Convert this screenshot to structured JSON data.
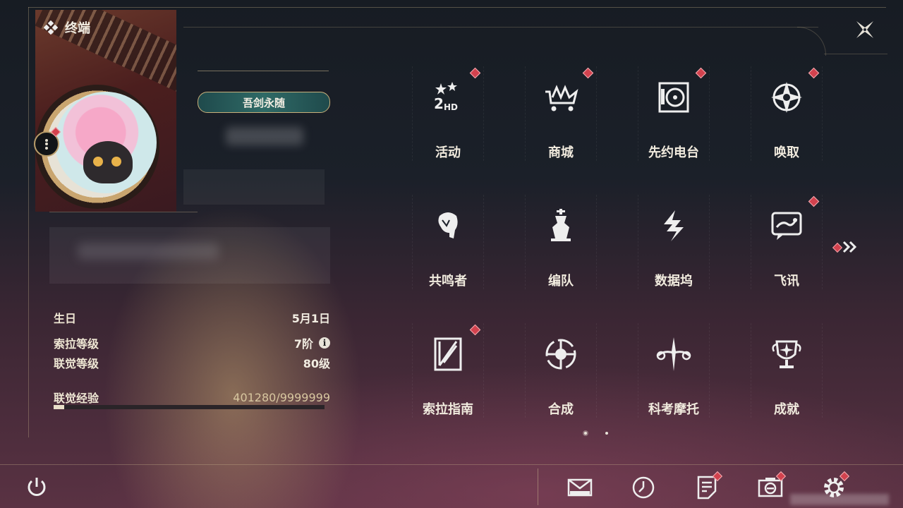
{
  "header": {
    "title": "终端"
  },
  "profile": {
    "title_badge": "吾剑永随",
    "stats": {
      "birthday_label": "生日",
      "birthday_value": "5月1日",
      "sola_level_label": "索拉等级",
      "sola_level_value": "7阶",
      "union_level_label": "联觉等级",
      "union_level_value": "80级",
      "union_exp_label": "联觉经验",
      "union_exp_value": "401280/9999999",
      "union_exp_progress": 0.04
    }
  },
  "menu": {
    "items": [
      {
        "label": "活动",
        "icon": "event-2hd-icon",
        "badge": true
      },
      {
        "label": "商城",
        "icon": "shop-cart-icon",
        "badge": true
      },
      {
        "label": "先约电台",
        "icon": "radio-icon",
        "badge": true
      },
      {
        "label": "唤取",
        "icon": "convene-icon",
        "badge": true
      },
      {
        "label": "共鸣者",
        "icon": "resonator-icon",
        "badge": false
      },
      {
        "label": "编队",
        "icon": "team-chess-icon",
        "badge": false
      },
      {
        "label": "数据坞",
        "icon": "data-bank-icon",
        "badge": false
      },
      {
        "label": "飞讯",
        "icon": "message-icon",
        "badge": true
      },
      {
        "label": "索拉指南",
        "icon": "guidebook-icon",
        "badge": true
      },
      {
        "label": "合成",
        "icon": "synthesis-icon",
        "badge": false
      },
      {
        "label": "科考摩托",
        "icon": "motorcycle-icon",
        "badge": false
      },
      {
        "label": "成就",
        "icon": "trophy-icon",
        "badge": false
      }
    ],
    "page_indicator": {
      "current": 1,
      "total": 2
    }
  },
  "bottom_bar": [
    {
      "name": "mail",
      "icon": "mail-icon",
      "badge": false
    },
    {
      "name": "time",
      "icon": "clock-icon",
      "badge": false
    },
    {
      "name": "notice",
      "icon": "notice-icon",
      "badge": true
    },
    {
      "name": "camera",
      "icon": "camera-icon",
      "badge": true
    },
    {
      "name": "settings",
      "icon": "gear-icon",
      "badge": true
    }
  ],
  "colors": {
    "accent_gold": "#c9b07a",
    "badge_red": "#d2424e",
    "text": "#f1ebde"
  }
}
